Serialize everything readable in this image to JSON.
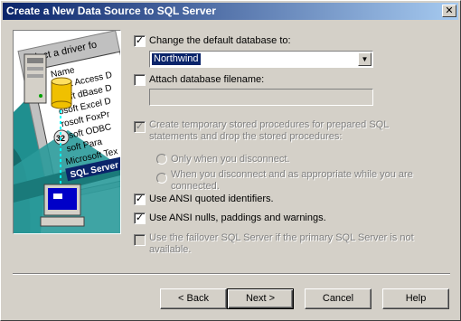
{
  "window": {
    "title": "Create a New Data Source to SQL Server",
    "close_glyph": "✕"
  },
  "illustration": {
    "banner": "Select a driver fo",
    "list_items": [
      "Name",
      "osoft Access D",
      "osoft dBase D",
      "osoft Excel D",
      "rosoft FoxPr",
      "osoft ODBC",
      "soft Para",
      "Microsoft Tex",
      "SQL Server"
    ],
    "icons": [
      "server-icon",
      "database-icon",
      "badge-32-icon",
      "computer-icon"
    ]
  },
  "options": {
    "change_db": {
      "label": "Change the default database to:",
      "checked": true
    },
    "database_value": "Northwind",
    "attach_file": {
      "label": "Attach database filename:",
      "checked": false
    },
    "attach_value": "",
    "create_temp": {
      "label": "Create temporary stored procedures for prepared SQL statements and drop the stored procedures:",
      "checked": true,
      "disabled": true
    },
    "radio_disconnect": {
      "label": "Only when you disconnect."
    },
    "radio_appropriate": {
      "label": "When you disconnect and as appropriate while you are connected."
    },
    "ansi_quoted": {
      "label": "Use ANSI quoted identifiers.",
      "checked": true
    },
    "ansi_nulls": {
      "label": "Use ANSI nulls, paddings and warnings.",
      "checked": true
    },
    "failover": {
      "label": "Use the failover SQL Server if the primary SQL Server is not available.",
      "checked": false,
      "disabled": true
    }
  },
  "buttons": {
    "back": "< Back",
    "next": "Next >",
    "cancel": "Cancel",
    "help": "Help"
  },
  "check_glyph": "✓",
  "colors": {
    "titlebar_start": "#0a246a",
    "titlebar_end": "#a6caf0",
    "face": "#d4d0c8",
    "teal": "#1f8f8f"
  }
}
